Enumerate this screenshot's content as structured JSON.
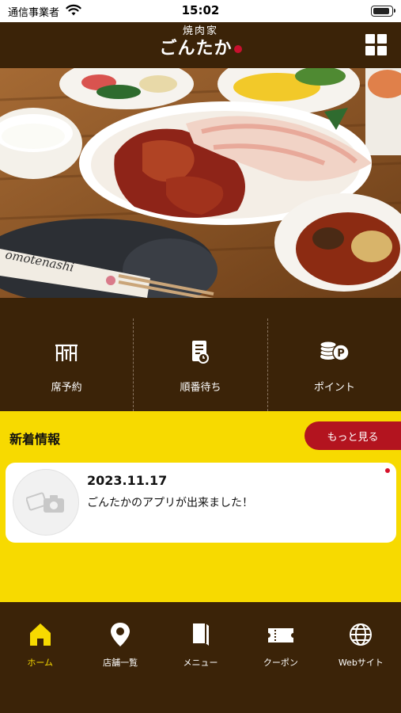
{
  "status_bar": {
    "carrier": "通信事業者",
    "time": "15:02"
  },
  "header": {
    "logo_top": "焼肉家",
    "logo_main": "ごんたか"
  },
  "hero": {
    "chopstick_text": "omotenashi"
  },
  "actions": [
    {
      "label": "席予約",
      "icon": "seat-reservation-icon"
    },
    {
      "label": "順番待ち",
      "icon": "queue-ticket-icon"
    },
    {
      "label": "ポイント",
      "icon": "points-coins-icon"
    }
  ],
  "news": {
    "title": "新着情報",
    "more_label": "もっと見る",
    "items": [
      {
        "date": "2023.11.17",
        "text": "ごんたかのアプリが出来ました！",
        "unread": true
      }
    ]
  },
  "tabs": [
    {
      "label": "ホーム",
      "icon": "home-icon",
      "active": true
    },
    {
      "label": "店舗一覧",
      "icon": "map-pin-icon",
      "active": false
    },
    {
      "label": "メニュー",
      "icon": "book-icon",
      "active": false
    },
    {
      "label": "クーポン",
      "icon": "ticket-icon",
      "active": false
    },
    {
      "label": "Webサイト",
      "icon": "globe-icon",
      "active": false
    }
  ],
  "colors": {
    "brand_brown": "#3b2308",
    "accent_yellow": "#f7da00",
    "accent_red": "#b3141f"
  }
}
